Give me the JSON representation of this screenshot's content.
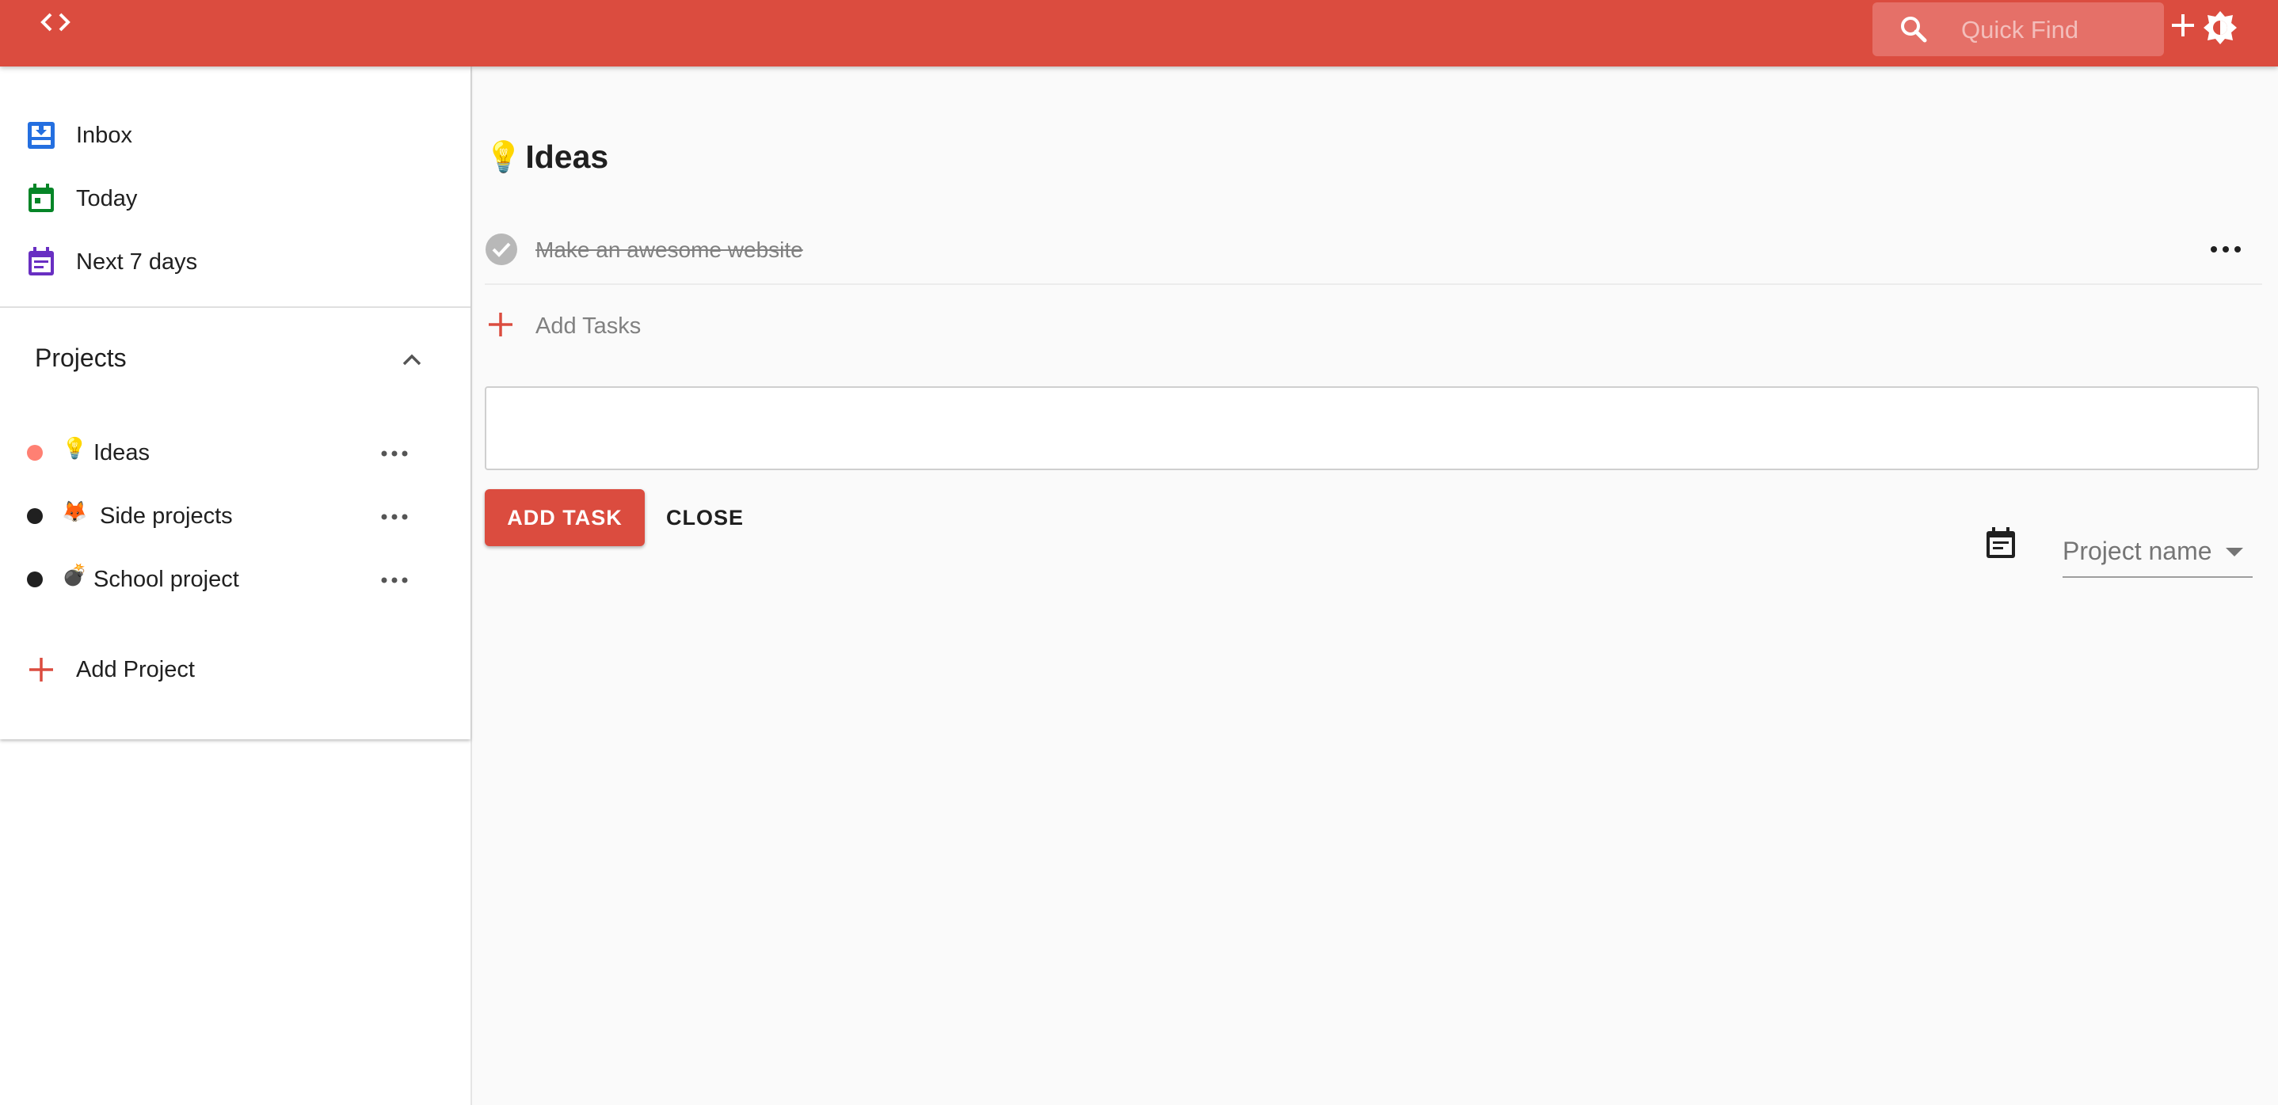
{
  "topbar": {
    "search_placeholder": "Quick Find",
    "accent_color": "#db4c3f"
  },
  "sidebar": {
    "nav": [
      {
        "label": "Inbox",
        "icon": "inbox-icon",
        "color": "#246fe0"
      },
      {
        "label": "Today",
        "icon": "calendar-today-icon",
        "color": "#058527"
      },
      {
        "label": "Next 7 days",
        "icon": "calendar-week-icon",
        "color": "#692fc2"
      }
    ],
    "projects_title": "Projects",
    "projects": [
      {
        "label": "Ideas",
        "emoji": "💡",
        "dot_color": "#ff8073"
      },
      {
        "label": "Side projects",
        "emoji": "🦊",
        "dot_color": "#202020"
      },
      {
        "label": "School project",
        "emoji": "💣",
        "dot_color": "#202020"
      }
    ],
    "add_project_label": "Add Project"
  },
  "main": {
    "title_emoji": "💡",
    "title": "Ideas",
    "tasks": [
      {
        "text": "Make an awesome website",
        "completed": true
      }
    ],
    "add_tasks_label": "Add Tasks",
    "add_task_button": "ADD TASK",
    "close_button": "CLOSE",
    "project_select_label": "Project name"
  }
}
